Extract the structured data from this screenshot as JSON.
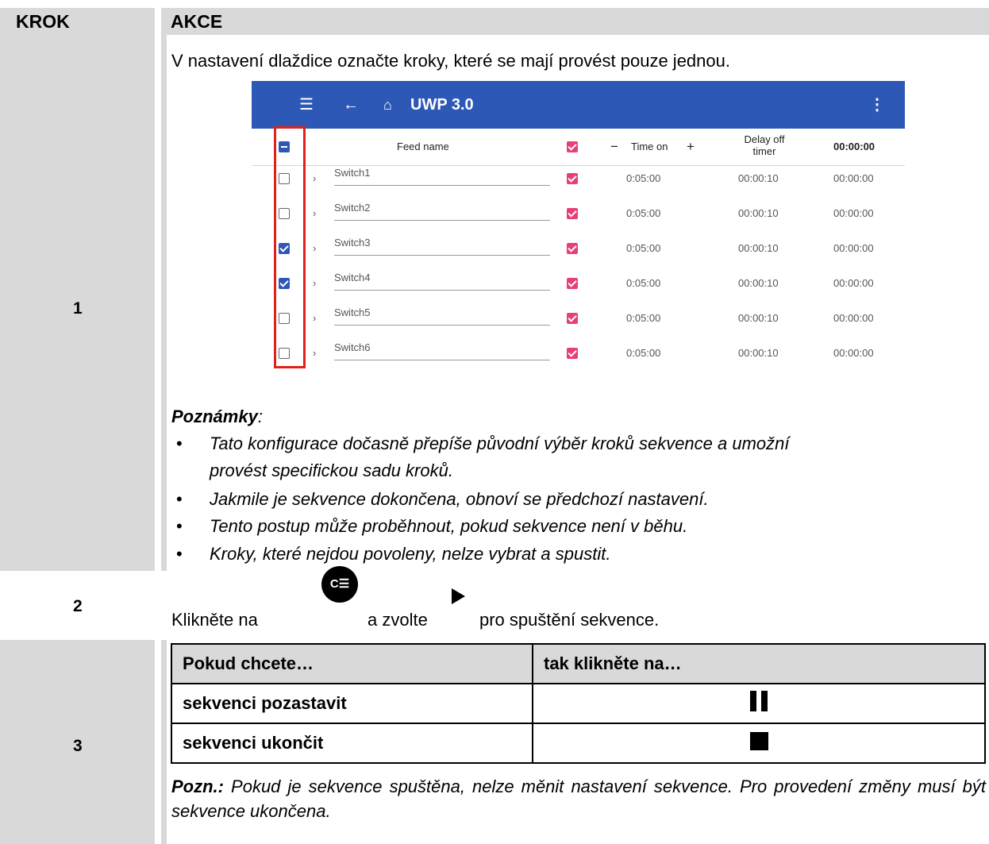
{
  "header": {
    "krok": "KROK",
    "akce": "AKCE"
  },
  "step1": {
    "number": "1",
    "intro": "V nastavení dlaždice označte kroky, které se mají provést pouze jednou.",
    "app": {
      "title": "UWP 3.0",
      "columns": {
        "feed_name": "Feed name",
        "time_on": "Time on",
        "delay_line1": "Delay off",
        "delay_line2": "timer",
        "timer": "00:00:00"
      },
      "rows": [
        {
          "name": "Switch1",
          "checked": false,
          "time_on": "0:05:00",
          "delay": "00:00:10",
          "timer": "00:00:00"
        },
        {
          "name": "Switch2",
          "checked": false,
          "time_on": "0:05:00",
          "delay": "00:00:10",
          "timer": "00:00:00"
        },
        {
          "name": "Switch3",
          "checked": true,
          "time_on": "0:05:00",
          "delay": "00:00:10",
          "timer": "00:00:00"
        },
        {
          "name": "Switch4",
          "checked": true,
          "time_on": "0:05:00",
          "delay": "00:00:10",
          "timer": "00:00:00"
        },
        {
          "name": "Switch5",
          "checked": false,
          "time_on": "0:05:00",
          "delay": "00:00:10",
          "timer": "00:00:00"
        },
        {
          "name": "Switch6",
          "checked": false,
          "time_on": "0:05:00",
          "delay": "00:00:10",
          "timer": "00:00:00"
        }
      ]
    },
    "notes_title": "Poznámky",
    "notes_colon": ":",
    "notes": [
      "Tato konfigurace dočasně přepíše původní výběr kroků sekvence a umožní",
      "provést specifickou sadu kroků.",
      "Jakmile je sekvence dokončena, obnoví se předchozí nastavení.",
      "Tento postup může proběhnout, pokud sekvence není v běhu.",
      "Kroky, které nejdou povoleny, nelze vybrat a spustit."
    ]
  },
  "step2": {
    "number": "2",
    "text_a": "Klikněte na",
    "icon_glyph": "C☰",
    "text_b": "a zvolte",
    "text_c": "pro spuštění sekvence."
  },
  "step3": {
    "number": "3",
    "table_header": [
      "Pokud chcete…",
      "tak klikněte na…"
    ],
    "rows": [
      "sekvenci pozastavit",
      "sekvenci ukončit"
    ],
    "note_label": "Pozn.:",
    "note_text": " Pokud je sekvence spuštěna, nelze měnit nastavení sekvence. Pro provedení změny musí být sekvence ukončena."
  }
}
